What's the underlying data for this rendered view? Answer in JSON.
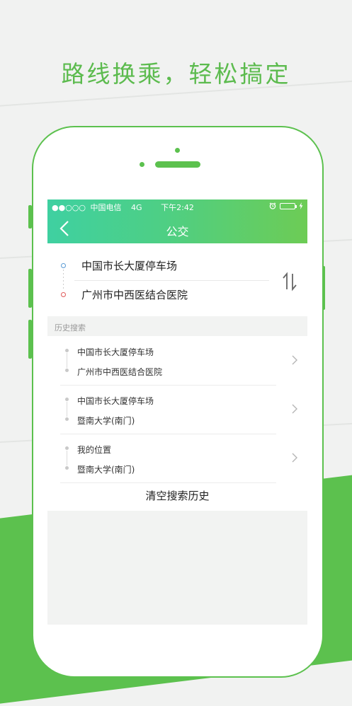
{
  "headline": "路线换乘，轻松搞定",
  "status_bar": {
    "signal": "●●○○○",
    "carrier": "中国电信",
    "network": "4G",
    "time": "下午2:42",
    "alarm_icon": "alarm-icon",
    "battery_icon": "battery-icon"
  },
  "nav": {
    "back_icon": "chevron-left-icon",
    "title": "公交"
  },
  "route": {
    "start": "中国市长大厦停车场",
    "end": "广州市中西医结合医院",
    "swap_icon": "swap-vertical-icon"
  },
  "history": {
    "label": "历史搜索",
    "items": [
      {
        "from": "中国市长大厦停车场",
        "to": "广州市中西医结合医院"
      },
      {
        "from": "中国市长大厦停车场",
        "to": "暨南大学(南门)"
      },
      {
        "from": "我的位置",
        "to": "暨南大学(南门)"
      }
    ],
    "clear_label": "清空搜索历史"
  },
  "colors": {
    "brand_green": "#5cc14e",
    "header_gradient_start": "#3fd0a1",
    "header_gradient_end": "#6dcc55",
    "start_dot": "#5b9bd5",
    "end_dot": "#e05a5a"
  }
}
